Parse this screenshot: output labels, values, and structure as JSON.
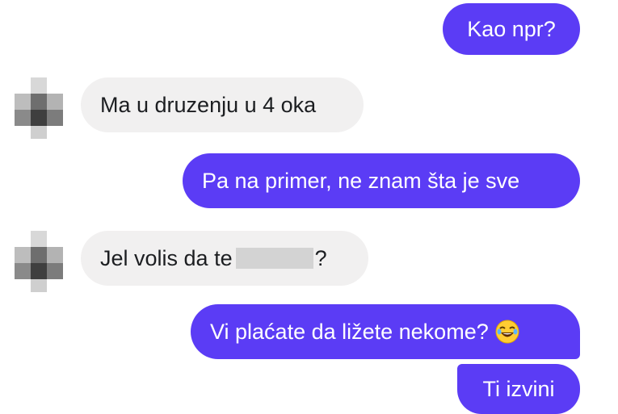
{
  "conversation": {
    "messages": [
      {
        "side": "outgoing",
        "text": "Kao npr?"
      },
      {
        "side": "incoming",
        "text": "Ma u druzenju u 4 oka"
      },
      {
        "side": "outgoing",
        "text": "Pa na primer, ne znam šta je sve"
      },
      {
        "side": "incoming",
        "text_before": "Jel volis da te",
        "text_after": "?"
      },
      {
        "side": "outgoing",
        "text": "Vi plaćate da ližete nekome?",
        "emoji": "laughing-face-icon"
      },
      {
        "side": "outgoing",
        "text": "Ti izvini"
      }
    ]
  },
  "colors": {
    "outgoing_bubble": "#5b3cf5",
    "incoming_bubble": "#f1f0f0",
    "redaction": "#d3d3d3"
  }
}
